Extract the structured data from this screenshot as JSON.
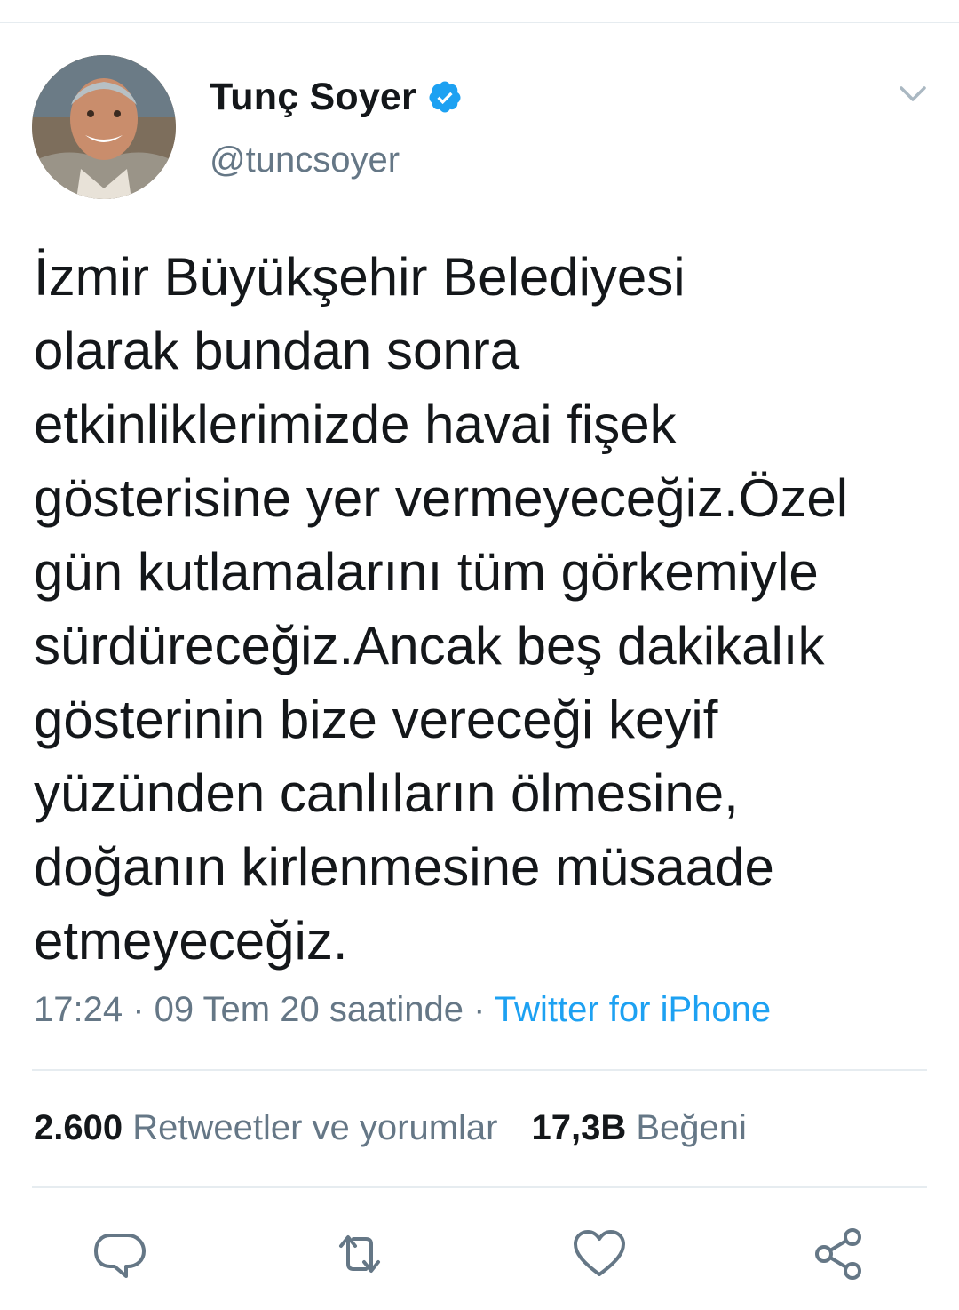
{
  "author": {
    "display_name": "Tunç Soyer",
    "handle": "@tuncsoyer",
    "verified": true
  },
  "tweet": {
    "lines": [
      "İzmir Büyükşehir Belediyesi",
      "olarak bundan sonra",
      "etkinliklerimizde havai fişek",
      "gösterisine yer vermeyeceğiz.Özel",
      "gün kutlamalarını tüm görkemiyle",
      "sürdüreceğiz.Ancak beş dakikalık",
      "gösterinin bize vereceği keyif",
      "yüzünden canlıların ölmesine,",
      "doğanın kirlenmesine müsaade",
      "etmeyeceğiz."
    ],
    "timestamp": "17:24 · 09 Tem 20 saatinde · ",
    "source": "Twitter for iPhone"
  },
  "stats": {
    "retweets_count": "2.600",
    "retweets_label": "Retweetler ve yorumlar",
    "likes_count": "17,3B",
    "likes_label": "Beğeni"
  },
  "icons": {
    "verified": "verified-badge-icon",
    "menu": "chevron-down-icon",
    "reply": "reply-icon",
    "retweet": "retweet-icon",
    "like": "heart-icon",
    "share": "share-icon"
  },
  "colors": {
    "text": "#14171a",
    "secondary": "#657786",
    "accent": "#1da1f2",
    "divider": "#e6ecf0"
  }
}
